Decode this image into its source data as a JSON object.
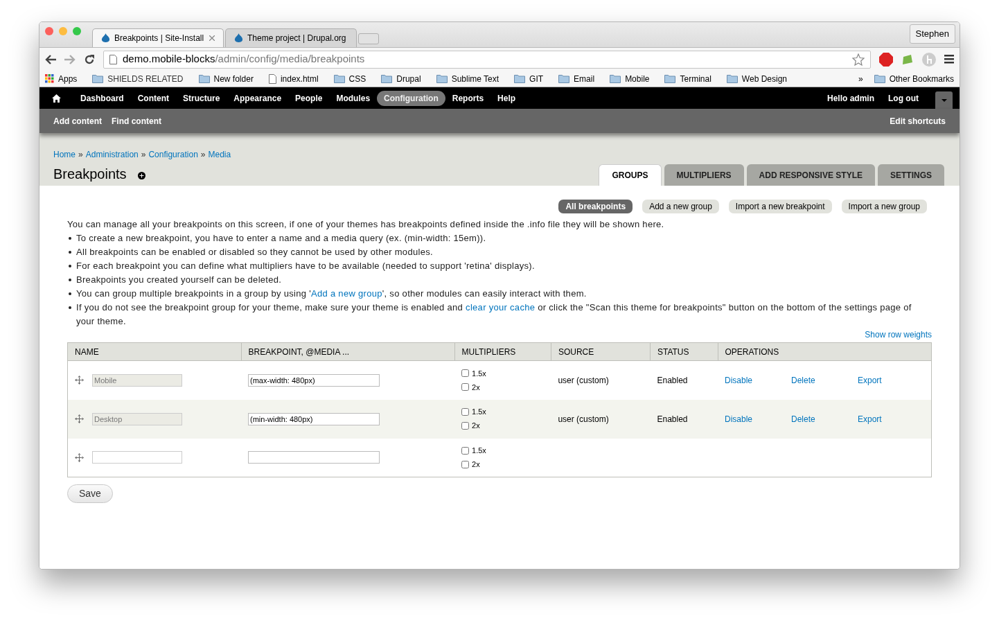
{
  "browser": {
    "tabs": [
      {
        "title": "Breakpoints | Site-Install",
        "selected": true
      },
      {
        "title": "Theme project | Drupal.org",
        "selected": false
      }
    ],
    "profile": "Stephen",
    "url": {
      "host": "demo.mobile-blocks",
      "path": "/admin/config/media/breakpoints"
    },
    "bookmarks": [
      {
        "label": "Apps",
        "kind": "apps"
      },
      {
        "label": "SHIELDS RELATED",
        "kind": "folder"
      },
      {
        "label": "New folder",
        "kind": "folder"
      },
      {
        "label": "index.html",
        "kind": "file"
      },
      {
        "label": "CSS",
        "kind": "folder"
      },
      {
        "label": "Drupal",
        "kind": "folder"
      },
      {
        "label": "Sublime Text",
        "kind": "folder"
      },
      {
        "label": "GIT",
        "kind": "folder"
      },
      {
        "label": "Email",
        "kind": "folder"
      },
      {
        "label": "Mobile",
        "kind": "folder"
      },
      {
        "label": "Terminal",
        "kind": "folder"
      },
      {
        "label": "Web Design",
        "kind": "folder"
      }
    ],
    "bookmarks_overflow": "»",
    "other_bookmarks": "Other Bookmarks"
  },
  "toolbar": {
    "items": [
      {
        "label": "Dashboard",
        "selected": false
      },
      {
        "label": "Content",
        "selected": false
      },
      {
        "label": "Structure",
        "selected": false
      },
      {
        "label": "Appearance",
        "selected": false
      },
      {
        "label": "People",
        "selected": false
      },
      {
        "label": "Modules",
        "selected": false
      },
      {
        "label": "Configuration",
        "selected": true
      },
      {
        "label": "Reports",
        "selected": false
      },
      {
        "label": "Help",
        "selected": false
      }
    ],
    "greeting": "Hello **admin**",
    "logout": "Log out",
    "shortcuts": [
      "Add content",
      "Find content"
    ],
    "edit_shortcuts": "Edit shortcuts"
  },
  "breadcrumb": [
    "Home",
    "Administration",
    "Configuration",
    "Media"
  ],
  "breadcrumb_separator": "»",
  "page_title": "Breakpoints",
  "tabs": [
    {
      "label": "GROUPS",
      "selected": true
    },
    {
      "label": "MULTIPLIERS",
      "selected": false
    },
    {
      "label": "ADD RESPONSIVE STYLE",
      "selected": false
    },
    {
      "label": "SETTINGS",
      "selected": false
    }
  ],
  "actions": [
    {
      "label": "All breakpoints",
      "selected": true
    },
    {
      "label": "Add a new group",
      "selected": false
    },
    {
      "label": "Import a new breakpoint",
      "selected": false
    },
    {
      "label": "Import a new group",
      "selected": false
    }
  ],
  "intro": "You can manage all your breakpoints on this screen, if one of your themes has breakpoints defined inside the .info file they will be shown here.",
  "bullets": [
    [
      {
        "text": "To create a new breakpoint, you have to enter a name and a media query (ex. (min-width: 15em))."
      }
    ],
    [
      {
        "text": "All breakpoints can be enabled or disabled so they cannot be used by other modules."
      }
    ],
    [
      {
        "text": "For each breakpoint you can define what multipliers have to be available (needed to support 'retina' displays)."
      }
    ],
    [
      {
        "text": "Breakpoints you created yourself can be deleted."
      }
    ],
    [
      {
        "text": "You can group multiple breakpoints in a group by using '"
      },
      {
        "link": "Add a new group"
      },
      {
        "text": "', so other modules can easily interact with them."
      }
    ],
    [
      {
        "text": "If you do not see the breakpoint group for your theme, make sure your theme is enabled and "
      },
      {
        "link": "clear your cache"
      },
      {
        "text": " or click the \"Scan this theme for breakpoints\" button on the bottom of the settings page of your theme."
      }
    ]
  ],
  "show_row_weights": "Show row weights",
  "table": {
    "columns": [
      "NAME",
      "BREAKPOINT, @MEDIA ...",
      "MULTIPLIERS",
      "SOURCE",
      "STATUS",
      "OPERATIONS"
    ],
    "rows": [
      {
        "name": {
          "value": "Mobile",
          "disabled": true
        },
        "media": "(max-width: 480px)",
        "multipliers": [
          {
            "label": "1.5x",
            "checked": false
          },
          {
            "label": "2x",
            "checked": false
          }
        ],
        "source": "user (custom)",
        "status": "Enabled",
        "operations": [
          "Disable",
          "Delete",
          "Export"
        ]
      },
      {
        "name": {
          "value": "Desktop",
          "disabled": true
        },
        "media": "(min-width: 480px)",
        "multipliers": [
          {
            "label": "1.5x",
            "checked": false
          },
          {
            "label": "2x",
            "checked": false
          }
        ],
        "source": "user (custom)",
        "status": "Enabled",
        "operations": [
          "Disable",
          "Delete",
          "Export"
        ]
      },
      {
        "name": {
          "disabled": false
        },
        "multipliers": [
          {
            "label": "1.5x",
            "checked": false
          },
          {
            "label": "2x",
            "checked": false
          }
        ]
      }
    ]
  },
  "save": "Save"
}
